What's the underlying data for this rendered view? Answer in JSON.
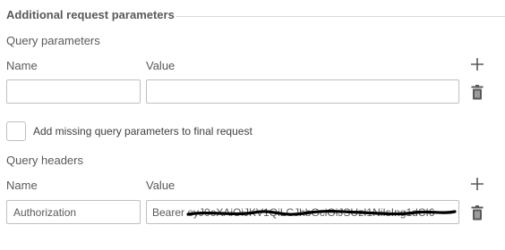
{
  "section": {
    "title": "Additional request parameters"
  },
  "query_parameters": {
    "label": "Query parameters",
    "name_label": "Name",
    "value_label": "Value",
    "rows": [
      {
        "name": "",
        "value": ""
      }
    ]
  },
  "add_missing_checkbox": {
    "label": "Add missing query parameters to final request",
    "checked": false
  },
  "query_headers": {
    "label": "Query headers",
    "name_label": "Name",
    "value_label": "Value",
    "rows": [
      {
        "name": "Authorization",
        "value": "Bearer eyJ0eXAiOiJKV1QiLCJhbGciOiJSUzI1NiIsIng1dCI6"
      }
    ]
  },
  "icons": {
    "add": "plus-icon",
    "delete": "trash-icon"
  },
  "colors": {
    "border": "#bfbfbf",
    "text": "#595959",
    "icon": "#595959",
    "redaction": "#000000"
  }
}
